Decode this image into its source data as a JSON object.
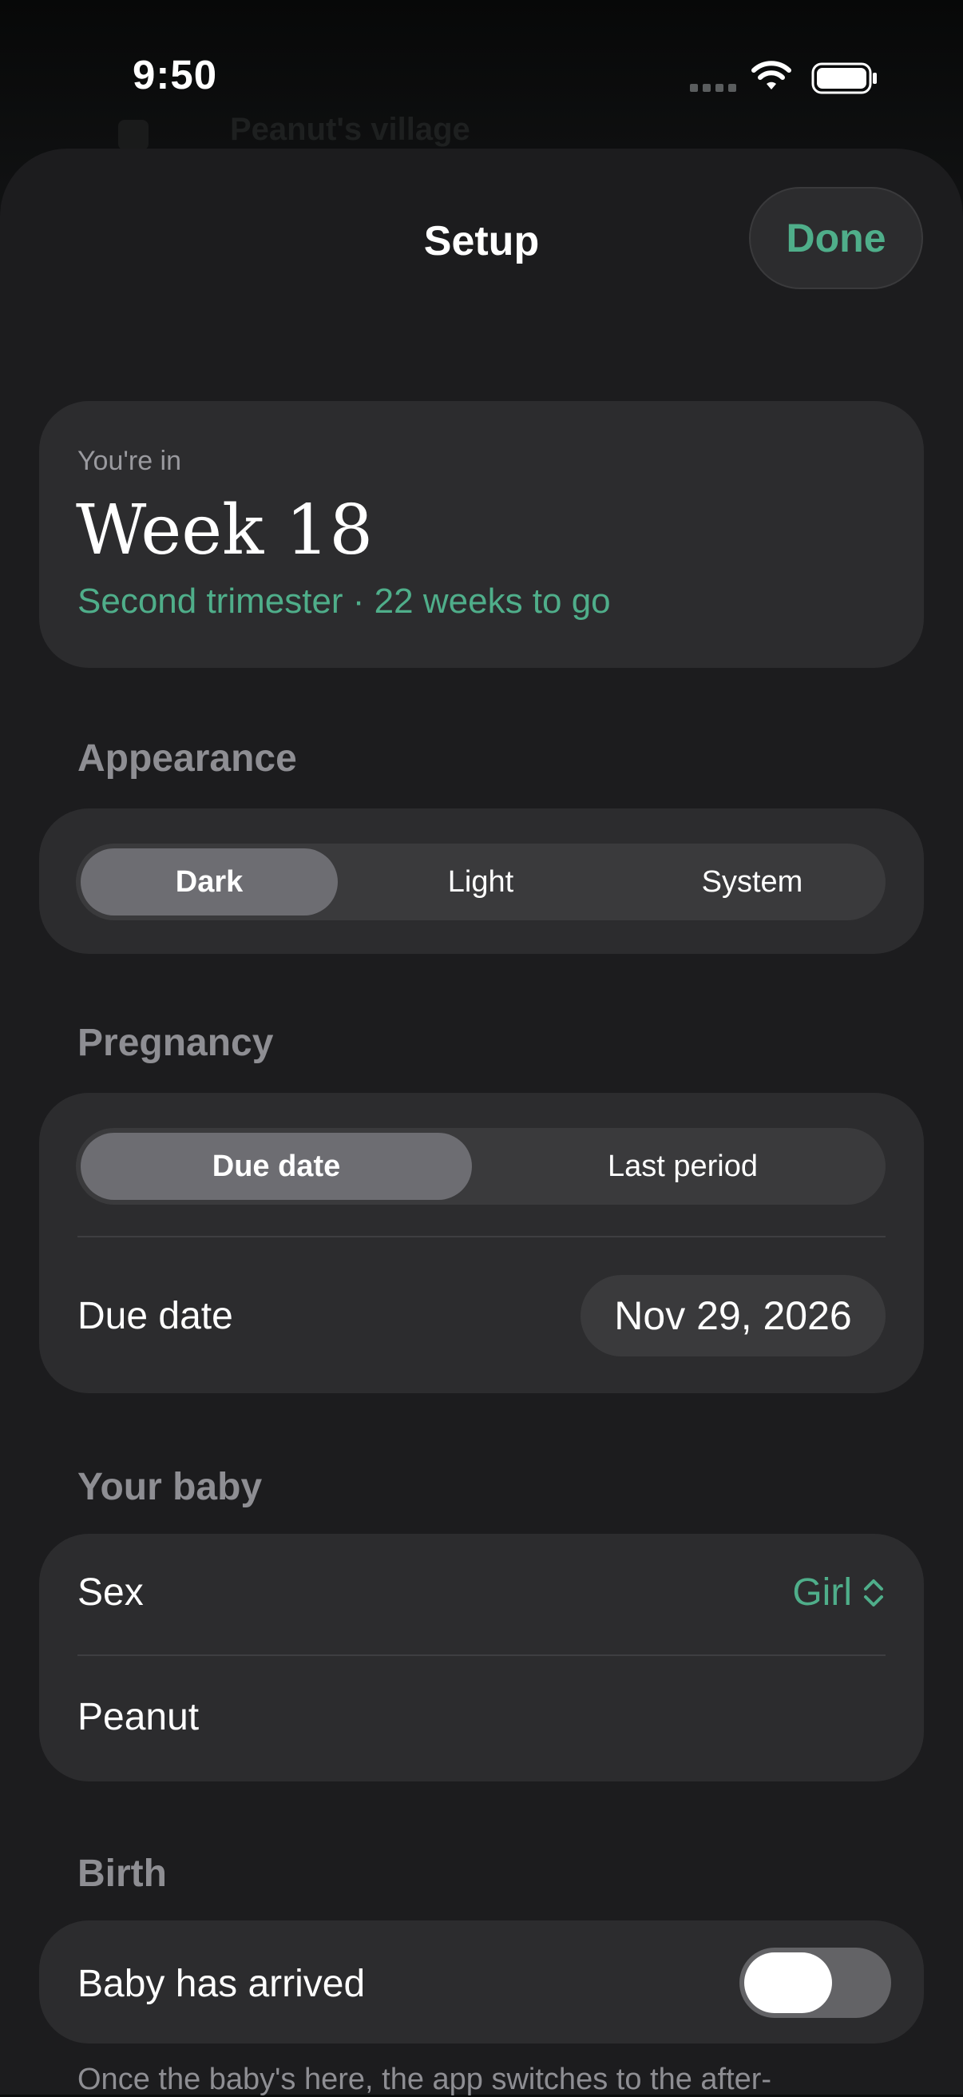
{
  "status_bar": {
    "time": "9:50"
  },
  "background": {
    "title": "Peanut's village"
  },
  "sheet": {
    "title": "Setup",
    "done_label": "Done"
  },
  "week_card": {
    "kicker": "You're in",
    "title": "Week 18",
    "subtitle": "Second trimester · 22 weeks to go"
  },
  "appearance": {
    "label": "Appearance",
    "options": [
      "Dark",
      "Light",
      "System"
    ],
    "selected": "Dark"
  },
  "pregnancy": {
    "label": "Pregnancy",
    "options": [
      "Due date",
      "Last period"
    ],
    "selected": "Due date",
    "row_label": "Due date",
    "date_value": "Nov 29, 2026"
  },
  "baby": {
    "label": "Your baby",
    "sex_label": "Sex",
    "sex_value": "Girl",
    "name": "Peanut"
  },
  "birth": {
    "label": "Birth",
    "arrived_label": "Baby has arrived",
    "arrived_on": false,
    "footnote": "Once the baby's here, the app switches to the after-"
  },
  "colors": {
    "accent": "#4fae8a",
    "card": "#2c2c2e",
    "sheet": "#1c1c1e"
  }
}
